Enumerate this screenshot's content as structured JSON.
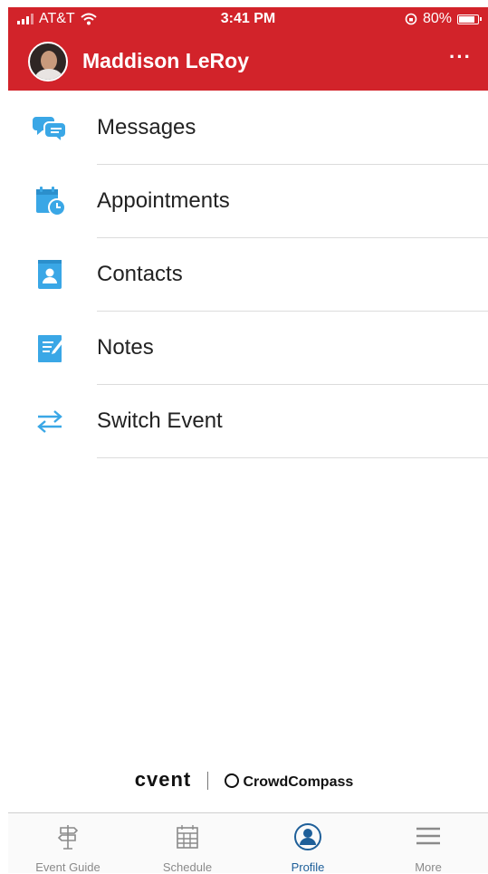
{
  "status": {
    "carrier": "AT&T",
    "time": "3:41 PM",
    "battery": "80%",
    "battery_level": 0.8
  },
  "header": {
    "user_name": "Maddison LeRoy",
    "more_label": "···",
    "color": "#d2232a"
  },
  "menu": {
    "items": [
      {
        "label": "Messages",
        "icon": "messages-icon"
      },
      {
        "label": "Appointments",
        "icon": "appointments-icon"
      },
      {
        "label": "Contacts",
        "icon": "contacts-icon"
      },
      {
        "label": "Notes",
        "icon": "notes-icon"
      },
      {
        "label": "Switch Event",
        "icon": "switch-event-icon"
      }
    ],
    "icon_color": "#3aa7e6"
  },
  "brand": {
    "cvent": "cvent",
    "crowdcompass": "CrowdCompass"
  },
  "tabbar": {
    "tabs": [
      {
        "label": "Event Guide",
        "icon": "signpost-icon",
        "active": false
      },
      {
        "label": "Schedule",
        "icon": "calendar-icon",
        "active": false
      },
      {
        "label": "Profile",
        "icon": "profile-icon",
        "active": true
      },
      {
        "label": "More",
        "icon": "menu-icon",
        "active": false
      }
    ],
    "active_color": "#1e5f99"
  }
}
